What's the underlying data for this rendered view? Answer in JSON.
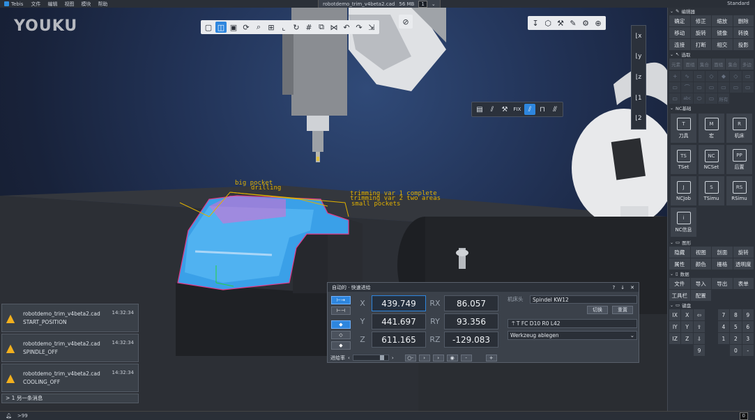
{
  "app": {
    "name": "Tebis",
    "menus": [
      "文件",
      "编辑",
      "视图",
      "模块",
      "帮助"
    ],
    "file_tab": "robotdemo_trim_v4beta2.cad",
    "file_size": "56 MB",
    "window_count": "1",
    "profile": "Standard"
  },
  "watermark": "YOUKU",
  "toolbar_top": [
    "cube-front-icon",
    "cube-iso-icon",
    "cube-side-icon",
    "rotate-icon",
    "zoom-icon",
    "zoom-window-icon",
    "axis-icon",
    "spin-icon",
    "grid-icon",
    "frame-icon",
    "clip-icon",
    "arrow-left-icon",
    "arrow-right-icon",
    "arrow-down-icon"
  ],
  "toolbar_top_active": 1,
  "toolbar_right": [
    "pin-icon",
    "box-icon",
    "tool-icon",
    "pen-icon",
    "wrench-icon",
    "gear-icon"
  ],
  "toolbar_mid": {
    "items": [
      "layout-icon",
      "slash-icon",
      "wrench-icon",
      "FIX",
      "tool-active-icon",
      "fixture-icon",
      "brush-icon"
    ],
    "active": 4
  },
  "scene_labels": [
    "big pocket",
    "drilling",
    "trimming var 1 complete",
    "trimming var 2 two areas",
    "small pockets"
  ],
  "notifications": [
    {
      "file": "robotdemo_trim_v4beta2.cad",
      "time": "14:32:34",
      "msg": "START_POSITION"
    },
    {
      "file": "robotdemo_trim_v4beta2.cad",
      "time": "14:32:34",
      "msg": "SPINDLE_OFF"
    },
    {
      "file": "robotdemo_trim_v4beta2.cad",
      "time": "14:32:34",
      "msg": "COOLING_OFF"
    }
  ],
  "notif_more": "> 1 另一条消息",
  "dialog": {
    "title": "自动的 · 快速进给",
    "ctl": [
      "?",
      "↓",
      "✕"
    ],
    "coords": [
      {
        "l": "X",
        "v": "439.749",
        "rl": "RX",
        "rv": "86.057"
      },
      {
        "l": "Y",
        "v": "441.697",
        "rl": "RY",
        "rv": "93.356"
      },
      {
        "l": "Z",
        "v": "611.165",
        "rl": "RZ",
        "rv": "-129.083"
      }
    ],
    "head_label": "机床头",
    "head_value": "Spindel KW12",
    "btn_switch": "切换",
    "btn_reset": "重置",
    "tool": "T FC D10 R0 L42",
    "action": "Werkzeug ablegen",
    "feed_label": "进给率"
  },
  "status": {
    "count": ">99",
    "right": "0"
  },
  "panel": {
    "editor": {
      "title": "编辑器",
      "buttons": [
        "确定",
        "修正",
        "缩放",
        "删除",
        "移动",
        "旋转",
        "镜像",
        "转换",
        "连接",
        "打断",
        "相交",
        "投影"
      ]
    },
    "select": {
      "title": "选取",
      "tabs": [
        "元素",
        "面组",
        "集合",
        "面组",
        "集合",
        "多边"
      ],
      "icons": [
        "+",
        "∿",
        "▭",
        "◇",
        "◆",
        "◇",
        "▭",
        "▭",
        "⌒",
        "▭",
        "▭",
        "▭",
        "▭",
        "▭",
        "▭",
        "abc",
        "⬭",
        "▭",
        "所有"
      ]
    },
    "nc": {
      "title": "NC基础",
      "items": [
        {
          "label": "刀具",
          "glyph": "T"
        },
        {
          "label": "宏",
          "glyph": "M"
        },
        {
          "label": "机床",
          "glyph": "R"
        },
        {
          "label": "TSet",
          "glyph": "TS"
        },
        {
          "label": "NCSet",
          "glyph": "NC"
        },
        {
          "label": "后置",
          "glyph": "PP"
        },
        {
          "label": "NCJob",
          "glyph": "J"
        },
        {
          "label": "TSimu",
          "glyph": "S"
        },
        {
          "label": "RSimu",
          "glyph": "RS"
        },
        {
          "label": "NC信息",
          "glyph": "i"
        }
      ]
    },
    "graphics": {
      "title": "图形",
      "buttons": [
        "隐藏",
        "视图",
        "剖面",
        "旋转",
        "属性",
        "颜色",
        "栅格",
        "透明度"
      ]
    },
    "data": {
      "title": "数据",
      "buttons": [
        "文件",
        "导入",
        "导出",
        "表单",
        "工具栏",
        "配置"
      ]
    },
    "keyboard": {
      "title": "键盘",
      "keys": [
        "IX",
        "X",
        "⇦",
        "",
        "7",
        "8",
        "9",
        "IY",
        "Y",
        "⇧",
        "",
        "4",
        "5",
        "6",
        "IZ",
        "Z",
        "⇩",
        "",
        "1",
        "2",
        "3",
        "",
        "",
        "9",
        "",
        "",
        "0",
        "-"
      ]
    }
  }
}
